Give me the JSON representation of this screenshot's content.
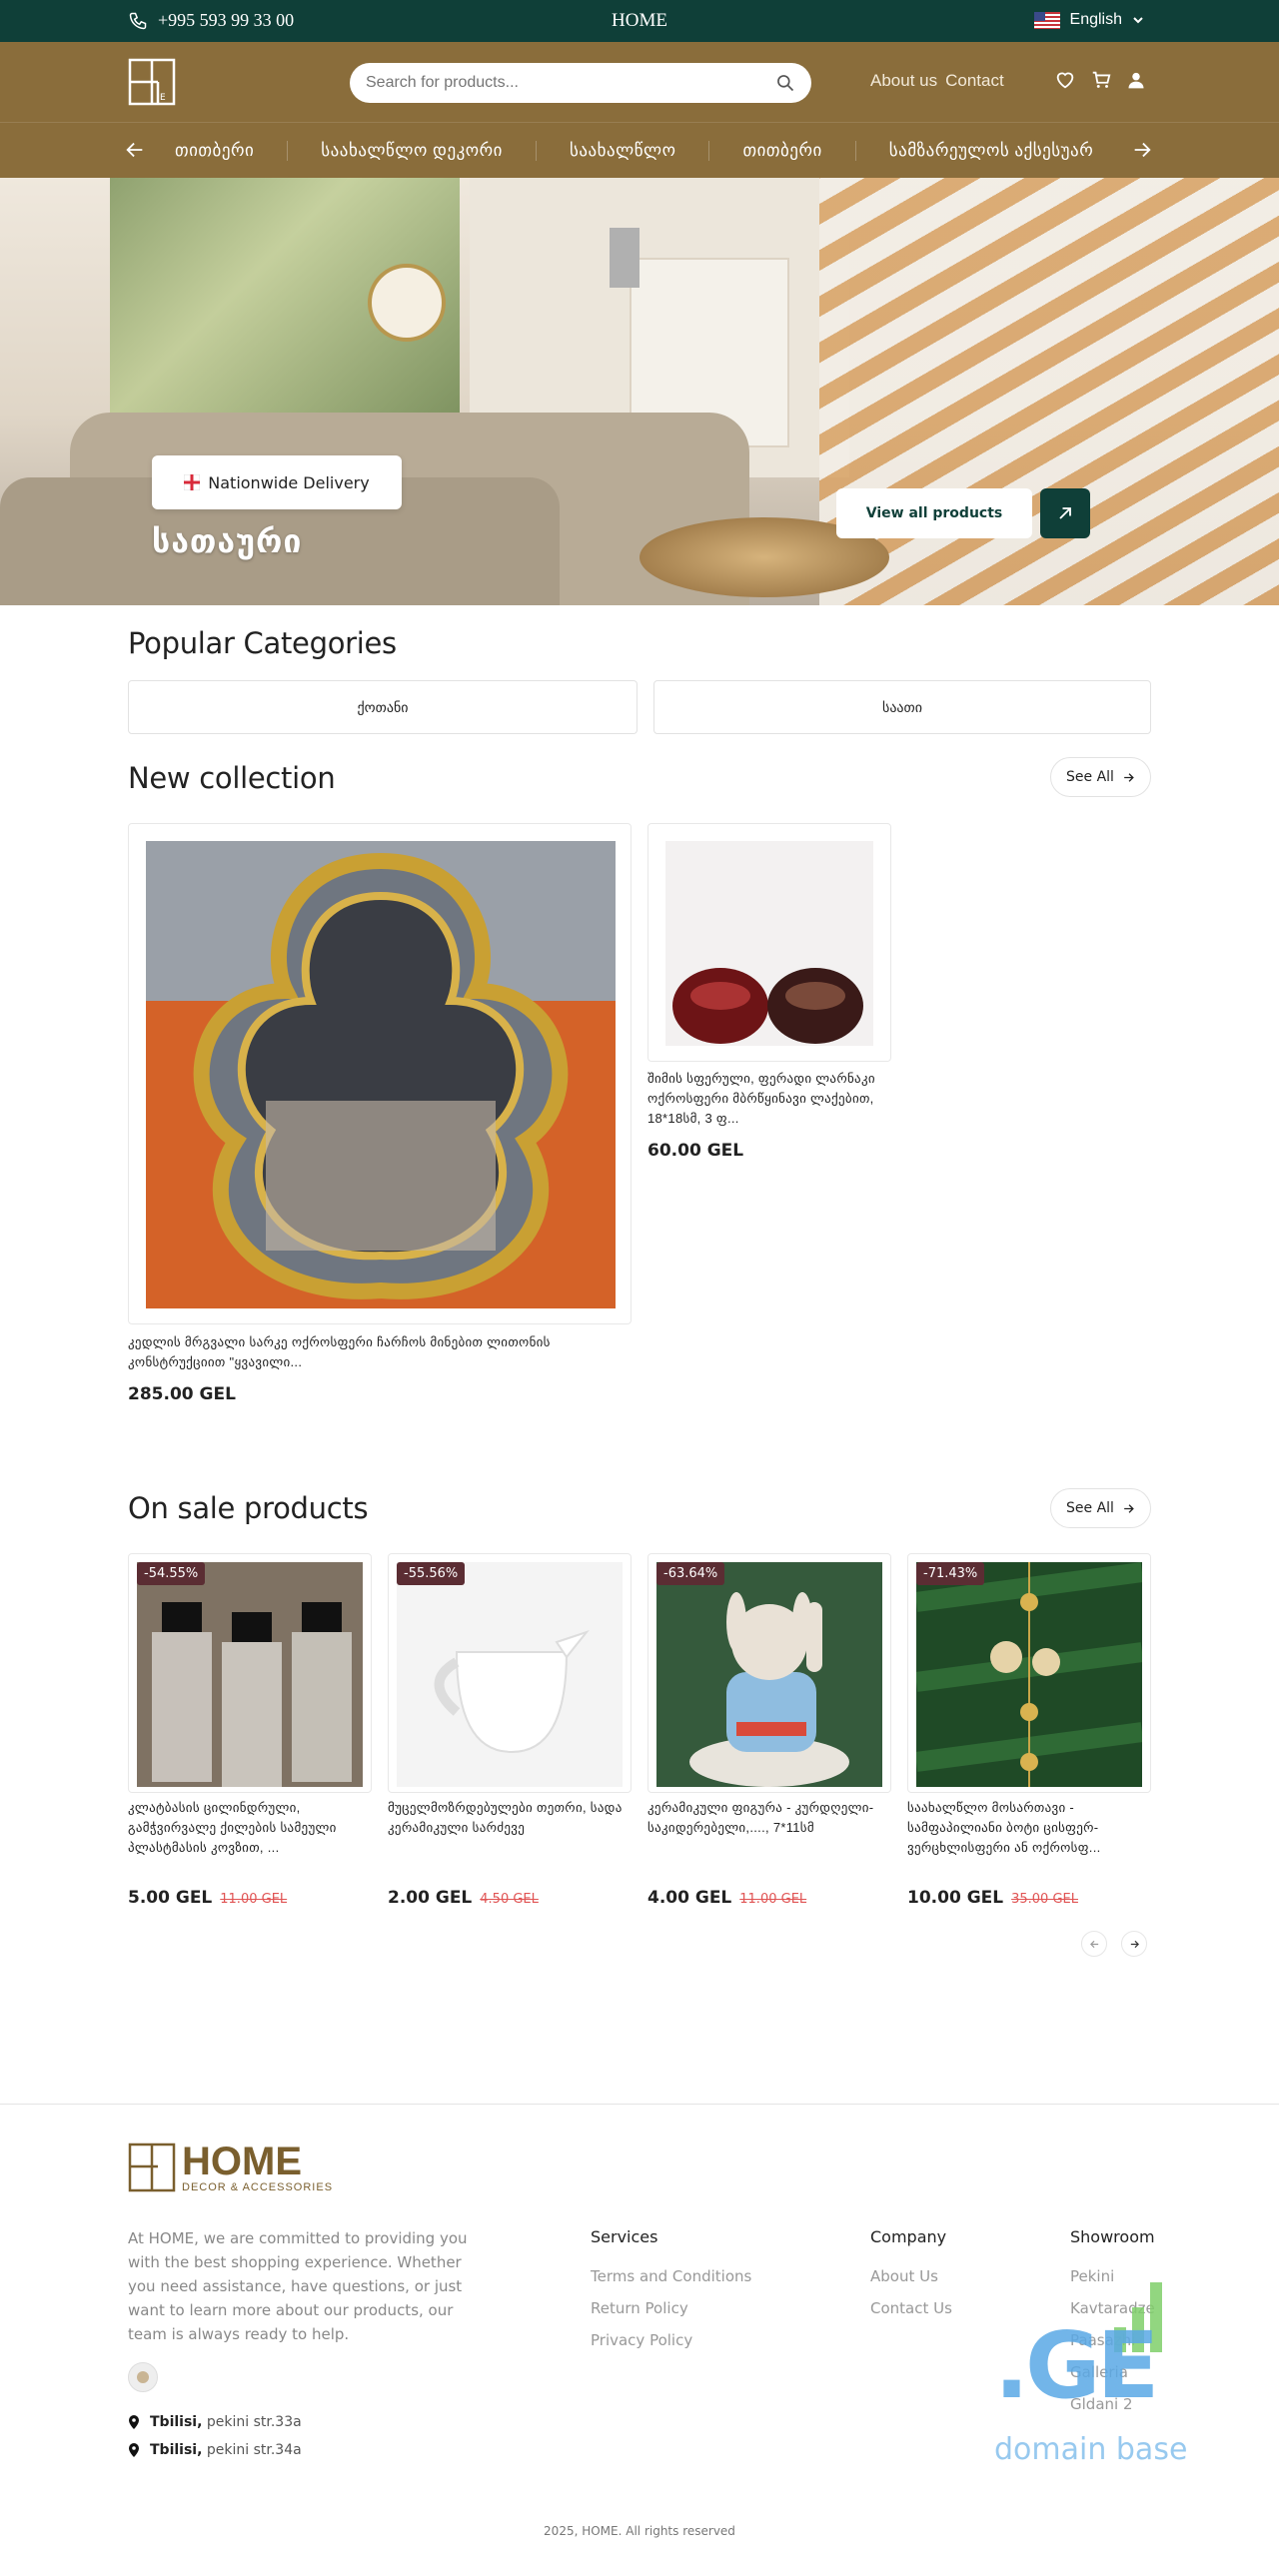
{
  "topbar": {
    "phone": "+995 593 99 33 00",
    "home": "HOME",
    "language": "English"
  },
  "header": {
    "search_placeholder": "Search for products...",
    "about": "About us",
    "contact": "Contact"
  },
  "catnav": {
    "items": [
      "თითბერი",
      "საახალწლო დეკორი",
      "საახალწლო",
      "თითბერი",
      "სამზარეულოს აქსესუარ"
    ]
  },
  "hero": {
    "badge": "Nationwide Delivery",
    "title": "სათაური",
    "view_all": "View all products"
  },
  "popular": {
    "title": "Popular Categories",
    "categories": [
      "ქოთანი",
      "საათი"
    ]
  },
  "new_collection": {
    "title": "New collection",
    "see_all": "See All",
    "products": [
      {
        "title": "კედლის მრგვალი სარკე ოქროსფერი ჩარჩოს მინებით ლითონის კონსტრუქციით \"ყვავილი...",
        "price": "285.00 GEL"
      },
      {
        "title": "შიმის სფერული, ფერადი ლარნაკი ოქროსფერი მბრწყინავი ლაქებით, 18*18სმ, 3 ფ...",
        "price": "60.00 GEL"
      }
    ]
  },
  "on_sale": {
    "title": "On sale products",
    "see_all": "See All",
    "products": [
      {
        "discount": "-54.55%",
        "title": "კლატბასის ცილინდრული, გამჭვირვალე ქილების სამეული პლასტმასის კოვზით, ...",
        "price": "5.00 GEL",
        "old_price": "11.00 GEL"
      },
      {
        "discount": "-55.56%",
        "title": "მუცელმოზრდებულები თეთრი, სადა კერამიკული სარძევე",
        "price": "2.00 GEL",
        "old_price": "4.50 GEL"
      },
      {
        "discount": "-63.64%",
        "title": "კერამიკული ფიგურა - კურდღელი-საკიდერებელი,...., 7*11სმ",
        "price": "4.00 GEL",
        "old_price": "11.00 GEL"
      },
      {
        "discount": "-71.43%",
        "title": "საახალწლო მოსართავი - სამფაპილიანი ბოტი ცისფერ-ვერცხლისფერი ან ოქროსფ...",
        "price": "10.00 GEL",
        "old_price": "35.00 GEL"
      }
    ]
  },
  "footer": {
    "logo_word": "HOME",
    "logo_sub": "DECOR & ACCESSORIES",
    "about": "At HOME, we are committed to providing you with the best shopping experience. Whether you need assistance, have questions, or just want to learn more about our products, our team is always ready to help.",
    "services_title": "Services",
    "services": [
      "Terms and Conditions",
      "Return Policy",
      "Privacy Policy"
    ],
    "company_title": "Company",
    "company": [
      "About Us",
      "Contact Us"
    ],
    "showroom_title": "Showroom",
    "showroom": [
      "Pekini",
      "Kavtaradze",
      "Paasazhi",
      "Galleria",
      "Gldani 2"
    ],
    "addresses": [
      {
        "city": "Tbilisi,",
        "street": "pekini str.33a"
      },
      {
        "city": "Tbilisi,",
        "street": "pekini str.34a"
      }
    ],
    "copyright": "2025, HOME. All rights reserved"
  },
  "watermark": {
    "ge": ".GE",
    "text": "domain base"
  }
}
